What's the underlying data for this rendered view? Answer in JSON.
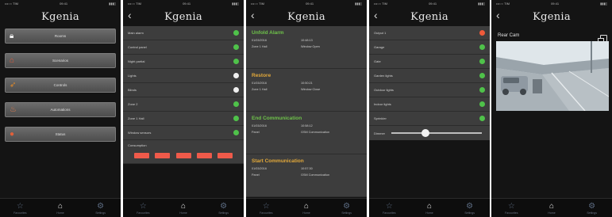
{
  "logo_text": "Kgenia",
  "status_bar": {
    "carrier": "•••○○ TIM",
    "time": "09:41",
    "battery": "▮▮▮▯"
  },
  "tab_bar": [
    {
      "label": "Favourites",
      "icon": "star-icon"
    },
    {
      "label": "Home",
      "icon": "house-icon"
    },
    {
      "label": "Settings",
      "icon": "gear-icon"
    }
  ],
  "menu_screen": {
    "items": [
      {
        "label": "Rooms",
        "icon": "lock-icon",
        "icon_color": "#f0f0f0"
      },
      {
        "label": "Scenarios",
        "icon": "house-icon",
        "icon_color": "#e05a3a"
      },
      {
        "label": "Controls",
        "icon": "satellite-icon",
        "icon_color": "#e08a2a"
      },
      {
        "label": "Automations",
        "icon": "lamp-icon",
        "icon_color": "#e07a4a"
      },
      {
        "label": "Status",
        "icon": "shield-icon",
        "icon_color": "#e0603a"
      }
    ]
  },
  "zones_screen": {
    "rows": [
      {
        "label": "Main alarm",
        "status": "green"
      },
      {
        "label": "Control panel",
        "status": "green"
      },
      {
        "label": "Night partial",
        "status": "green"
      },
      {
        "label": "Lights",
        "status": "white"
      },
      {
        "label": "Blinds",
        "status": "white"
      },
      {
        "label": "Zone 2",
        "status": "green"
      },
      {
        "label": "Zone 1 Hall",
        "status": "green"
      },
      {
        "label": "Window sensors",
        "status": "green"
      }
    ],
    "gauge": {
      "label": "Consumption",
      "bar_count": 5,
      "bar_color": "#ef5a4a"
    }
  },
  "events_screen": {
    "events": [
      {
        "title": "Unfold Alarm",
        "title_color": "#6ec24a",
        "date": "01/03/2016",
        "time": "10:48:13",
        "source": "Zone 1 Hall",
        "detail": "Window Open"
      },
      {
        "title": "Restore",
        "title_color": "#e3a93a",
        "date": "01/03/2016",
        "time": "10:50:21",
        "source": "Zone 1 Hall",
        "detail": "Window Close"
      },
      {
        "title": "End Communication",
        "title_color": "#6ec24a",
        "date": "01/03/2016",
        "time": "10:58:12",
        "source": "Panel",
        "detail": "GSM Communication"
      },
      {
        "title": "Start Communication",
        "title_color": "#e3a93a",
        "date": "01/03/2016",
        "time": "10:57:30",
        "source": "Panel",
        "detail": "GSM Communication"
      }
    ]
  },
  "outputs_screen": {
    "rows": [
      {
        "label": "Output 1",
        "status": "red"
      },
      {
        "label": "Garage",
        "status": "green"
      },
      {
        "label": "Gate",
        "status": "green"
      },
      {
        "label": "Garden lights",
        "status": "green"
      },
      {
        "label": "Outdoor lights",
        "status": "green"
      },
      {
        "label": "Indoor lights",
        "status": "green"
      },
      {
        "label": "Sprinkler",
        "status": "green"
      }
    ],
    "slider": {
      "label": "Dimmer",
      "value_fraction": 0.38
    }
  },
  "camera_screen": {
    "title": "Rear Cam"
  },
  "colors": {
    "green": "#4fc24a",
    "red": "#ef5a3a",
    "white": "#f0f0f0",
    "panel": "#3d3d3d",
    "background": "#141414"
  }
}
